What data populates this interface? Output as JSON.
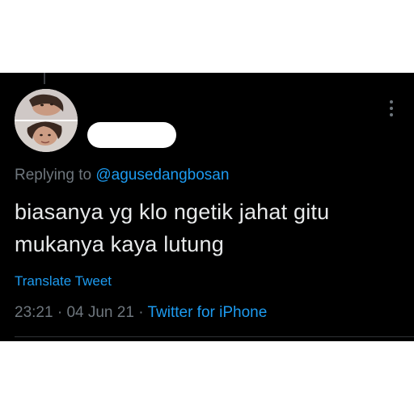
{
  "tweet": {
    "replying_prefix": "Replying to ",
    "replying_handle": "@agusedangbosan",
    "text_line1": "biasanya yg klo ngetik jahat gitu",
    "text_line2": "mukanya kaya lutung",
    "translate_label": "Translate Tweet",
    "time": "23:21",
    "separator": "·",
    "date": "04 Jun 21",
    "source": "Twitter for iPhone"
  },
  "icons": {
    "more": "more-vertical-icon",
    "avatar": "profile-photo"
  },
  "colors": {
    "background": "#000000",
    "text": "#e7e9ea",
    "muted": "#6e767d",
    "accent": "#1d9bf0"
  }
}
